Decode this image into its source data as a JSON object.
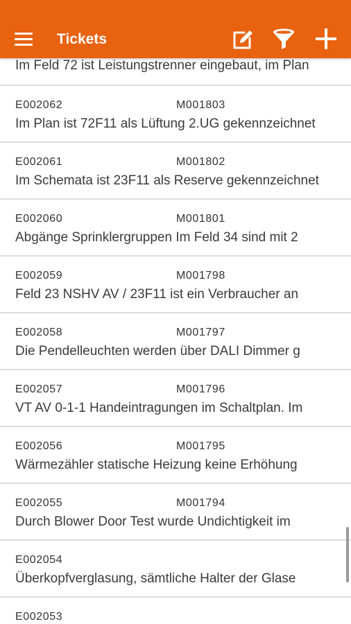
{
  "app_bar": {
    "title": "Tickets",
    "background_color": "#e8620f",
    "icons": [
      "menu-icon",
      "edit-icon",
      "filter-icon",
      "add-icon"
    ]
  },
  "partial_ticket": {
    "description": "Im Feld 72 ist Leistungstrenner eingebaut, im Plan"
  },
  "tickets": [
    {
      "ticket_id": "E002062",
      "ref_id": "M001803",
      "description": "Im Plan ist 72F11 als Lüftung 2.UG gekennzeichnet"
    },
    {
      "ticket_id": "E002061",
      "ref_id": "M001802",
      "description": "Im Schemata ist 23F11 als Reserve gekennzeichnet"
    },
    {
      "ticket_id": "E002060",
      "ref_id": "M001801",
      "description": "Abgänge Sprinklergruppen Im Feld 34 sind mit 2"
    },
    {
      "ticket_id": "E002059",
      "ref_id": "M001798",
      "description": "Feld 23 NSHV AV / 23F11 ist ein Verbraucher an"
    },
    {
      "ticket_id": "E002058",
      "ref_id": "M001797",
      "description": "Die Pendelleuchten werden über DALI Dimmer g"
    },
    {
      "ticket_id": "E002057",
      "ref_id": "M001796",
      "description": "VT AV 0-1-1 Handeintragungen im Schaltplan. Im"
    },
    {
      "ticket_id": "E002056",
      "ref_id": "M001795",
      "description": "Wärmezähler statische Heizung keine Erhöhung"
    },
    {
      "ticket_id": "E002055",
      "ref_id": "M001794",
      "description": "Durch Blower Door Test wurde Undichtigkeit im"
    },
    {
      "ticket_id": "E002054",
      "ref_id": "",
      "description": "Überkopfverglasung, sämtliche Halter der Glase"
    },
    {
      "ticket_id": "E002053",
      "ref_id": "",
      "description": ""
    }
  ]
}
